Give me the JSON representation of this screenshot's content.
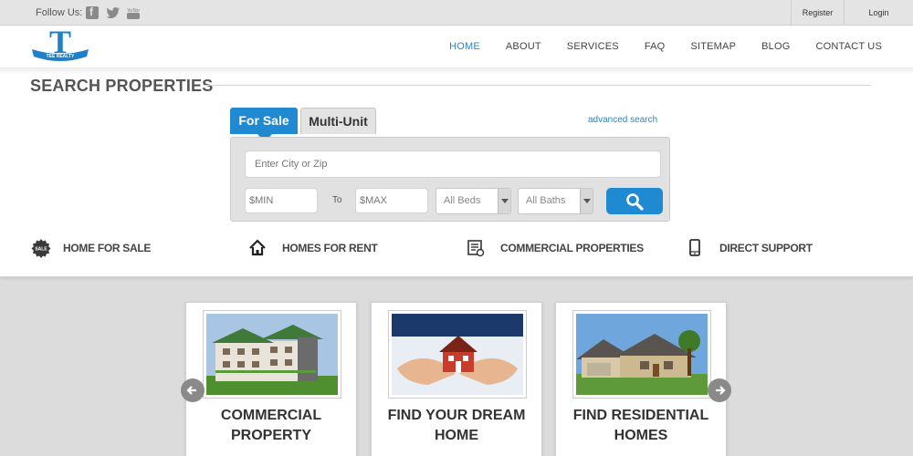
{
  "topbar": {
    "follow_label": "Follow Us:",
    "social_icons": [
      "facebook-icon",
      "twitter-icon",
      "youtube-icon"
    ],
    "youtube_text": "You Tube",
    "register": "Register",
    "login": "Login"
  },
  "header": {
    "logo_letter": "T",
    "logo_banner": "TEE REALTY",
    "nav": [
      {
        "label": "HOME",
        "active": true
      },
      {
        "label": "ABOUT"
      },
      {
        "label": "SERVICES"
      },
      {
        "label": "FAQ"
      },
      {
        "label": "SITEMAP"
      },
      {
        "label": "BLOG"
      },
      {
        "label": "CONTACT US"
      }
    ],
    "accent_color": "#2b87c6"
  },
  "search": {
    "title": "SEARCH PROPERTIES",
    "tabs": [
      {
        "label": "For Sale",
        "active": true
      },
      {
        "label": "Multi-Unit"
      }
    ],
    "advanced_link": "advanced search",
    "city_placeholder": "Enter City or Zip",
    "min_placeholder": "$MIN",
    "to_label": "To",
    "max_placeholder": "$MAX",
    "beds_value": "All Beds",
    "baths_value": "All Baths",
    "search_icon": "magnifier-icon"
  },
  "features": [
    {
      "label": "HOME FOR SALE",
      "icon": "sale-badge-icon",
      "badge_text": "SALE"
    },
    {
      "label": "HOMES FOR RENT",
      "icon": "house-icon"
    },
    {
      "label": "COMMERCIAL PROPERTIES",
      "icon": "document-icon"
    },
    {
      "label": "DIRECT SUPPORT",
      "icon": "mobile-phone-icon"
    }
  ],
  "cards": [
    {
      "title_line1": "COMMERCIAL",
      "title_line2": "PROPERTY"
    },
    {
      "title_line1": "FIND YOUR DREAM",
      "title_line2": "HOME"
    },
    {
      "title_line1": "FIND RESIDENTIAL",
      "title_line2": "HOMES"
    }
  ]
}
